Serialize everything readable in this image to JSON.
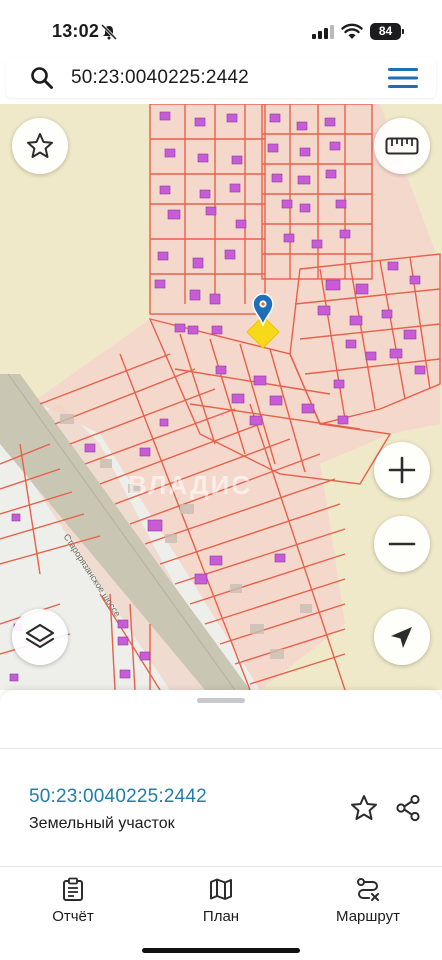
{
  "status_bar": {
    "time": "13:02",
    "battery": "84"
  },
  "search": {
    "value": "50:23:0040225:2442"
  },
  "map": {
    "watermark": "ВЛАДИС",
    "road_label": "Старорязанское шоссе",
    "colors": {
      "background": "#efe9c9",
      "parcel_fill": "#f6d9cc",
      "parcel_border": "#e8604a",
      "building": "#c75cd6",
      "marker": "#1e6fb8",
      "highlight": "#f7d91a"
    }
  },
  "sheet": {
    "parcel_id": "50:23:0040225:2442",
    "parcel_type": "Земельный участок"
  },
  "tabs": [
    {
      "label": "Отчёт",
      "icon": "report-icon"
    },
    {
      "label": "План",
      "icon": "map-icon"
    },
    {
      "label": "Маршрут",
      "icon": "route-icon"
    }
  ]
}
